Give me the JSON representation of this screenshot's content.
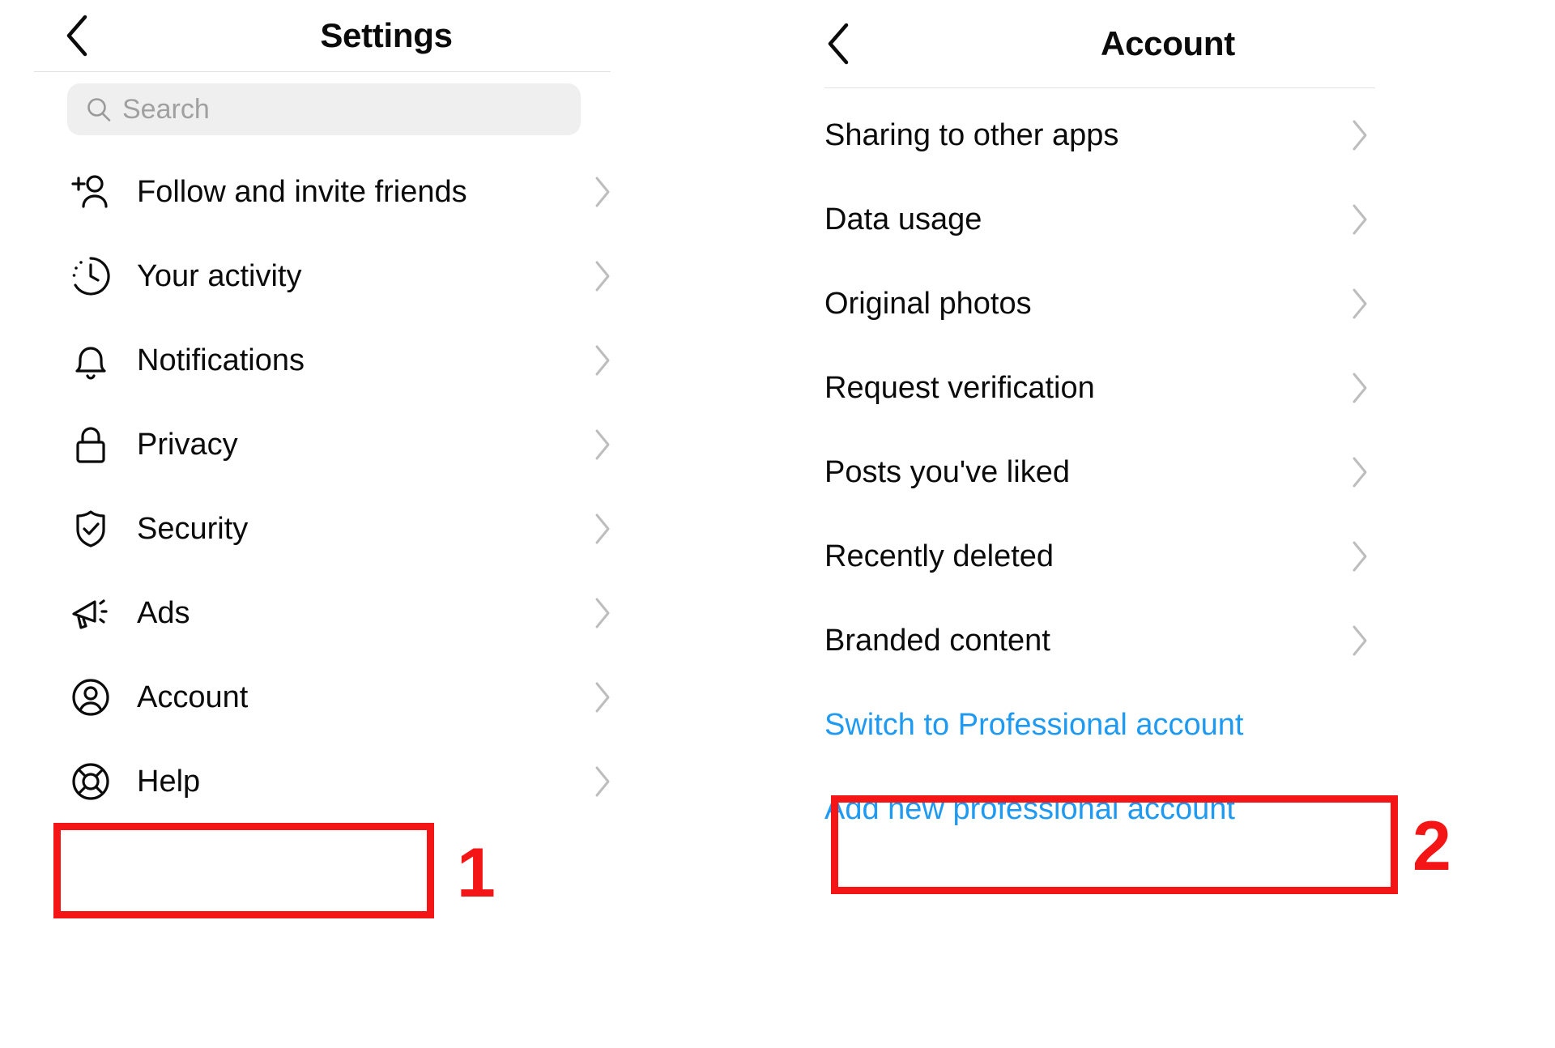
{
  "annotations": {
    "accent_color": "#f41616",
    "step_one": "1",
    "step_two": "2"
  },
  "colors": {
    "link_blue": "#1e9af3",
    "text_primary": "#0b0b0b",
    "chevron_gray": "#bdbdbd",
    "search_bg": "#efefef"
  },
  "left_panel": {
    "header": {
      "title": "Settings",
      "back_icon": "chevron-left-icon"
    },
    "search": {
      "placeholder": "Search",
      "value": "",
      "icon": "search-icon"
    },
    "items": [
      {
        "label": "Follow and invite friends",
        "icon": "person-plus-icon",
        "chevron": "chevron-right-icon"
      },
      {
        "label": "Your activity",
        "icon": "clock-activity-icon",
        "chevron": "chevron-right-icon"
      },
      {
        "label": "Notifications",
        "icon": "bell-icon",
        "chevron": "chevron-right-icon"
      },
      {
        "label": "Privacy",
        "icon": "lock-icon",
        "chevron": "chevron-right-icon"
      },
      {
        "label": "Security",
        "icon": "shield-check-icon",
        "chevron": "chevron-right-icon"
      },
      {
        "label": "Ads",
        "icon": "megaphone-icon",
        "chevron": "chevron-right-icon"
      },
      {
        "label": "Account",
        "icon": "person-circle-icon",
        "chevron": "chevron-right-icon"
      },
      {
        "label": "Help",
        "icon": "life-ring-icon",
        "chevron": "chevron-right-icon"
      }
    ]
  },
  "right_panel": {
    "header": {
      "title": "Account",
      "back_icon": "chevron-left-icon"
    },
    "items": [
      {
        "label": "Sharing to other apps",
        "chevron": "chevron-right-icon",
        "link": false
      },
      {
        "label": "Data usage",
        "chevron": "chevron-right-icon",
        "link": false
      },
      {
        "label": "Original photos",
        "chevron": "chevron-right-icon",
        "link": false
      },
      {
        "label": "Request verification",
        "chevron": "chevron-right-icon",
        "link": false
      },
      {
        "label": "Posts you've liked",
        "chevron": "chevron-right-icon",
        "link": false
      },
      {
        "label": "Recently deleted",
        "chevron": "chevron-right-icon",
        "link": false
      },
      {
        "label": "Branded content",
        "chevron": "chevron-right-icon",
        "link": false
      },
      {
        "label": "Switch to Professional account",
        "chevron": "",
        "link": true
      },
      {
        "label": "Add new professional account",
        "chevron": "",
        "link": true
      }
    ]
  }
}
